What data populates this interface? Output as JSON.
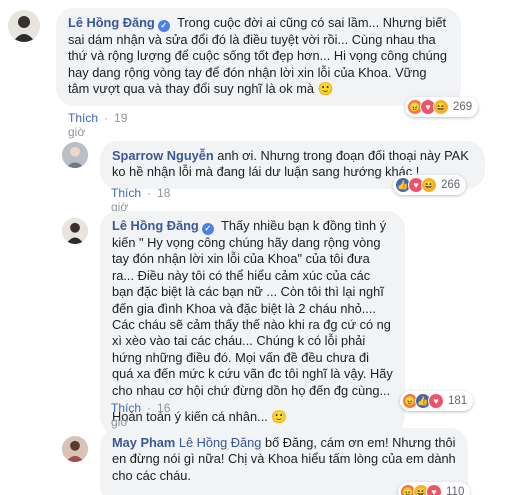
{
  "comments": [
    {
      "author": "Lê Hồng Đăng",
      "verified": true,
      "text": "Trong cuộc đời ai cũng có sai lầm... Nhưng biết sai dám nhận và sửa đổi đó là điều tuyệt vời rồi... Cùng nhau tha thứ và rộng lượng để cuộc sống tốt đẹp hơn... Hi vọng công chúng hay dang rộng vòng tay để đón nhận lời xin lỗi của Khoa. Vững tâm vượt qua và thay đổi suy nghĩ là ok mà",
      "emoji": "🙂",
      "like_label": "Thích",
      "time": "19 giờ",
      "reaction_count": "269",
      "reactions": [
        "angry",
        "love",
        "haha"
      ]
    },
    {
      "author": "Sparrow Nguyễn",
      "verified": false,
      "text": "anh ơi. Nhưng trong đoạn đối thoại này PAK ko hề nhận lỗi mà đang lái dư luận sang hướng khác !",
      "like_label": "Thích",
      "time": "18 giờ",
      "reaction_count": "266",
      "reactions": [
        "like",
        "love",
        "haha"
      ]
    },
    {
      "author": "Lê Hồng Đăng",
      "verified": true,
      "text": "Thấy nhiều bạn k đồng tình ý kiến \" Hy vọng công chúng hãy dang rộng vòng tay đón nhận lời xin lỗi của Khoa\" của tôi đưa ra... Điều này tôi có thể hiểu cảm xúc của các bạn đặc biệt là các bạn nữ ... Còn tôi thì lại nghĩ đến gia đình Khoa và đặc biệt là 2 cháu nhỏ.... Các cháu sẽ cảm thấy thế nào khi ra đg cứ có ng xì xèo vào tai các cháu... Chúng k có lỗi phải hứng những điều đó. Mọi vấn đề đều chưa đi quá xa đến mức k cứu vãn đc tôi nghĩ là vậy. Hãy cho nhau cơ hội chứ đừng dồn họ đến đg cùng...",
      "text2": "Hoàn toàn ý kiến cá nhân...",
      "emoji": "🙂",
      "like_label": "Thích",
      "time": "16 giờ",
      "reaction_count": "181",
      "reactions": [
        "angry",
        "like",
        "love"
      ]
    },
    {
      "author": "May Pham",
      "verified": false,
      "mention": "Lê Hồng Đăng",
      "text": "bố Đăng, cám ơn em! Nhưng thôi en đừng nói gì nữa! Chị và Khoa hiểu tấm lòng của em dành cho các cháu.",
      "reaction_count": "110",
      "reactions": [
        "angry",
        "haha",
        "love"
      ]
    }
  ],
  "colors": {
    "link": "#385898",
    "like": "#4267b2",
    "bubble": "#f2f3f5",
    "angry": "#f7714c",
    "love": "#f25268",
    "haha": "#f7b125",
    "like_react": "#4267b2"
  }
}
